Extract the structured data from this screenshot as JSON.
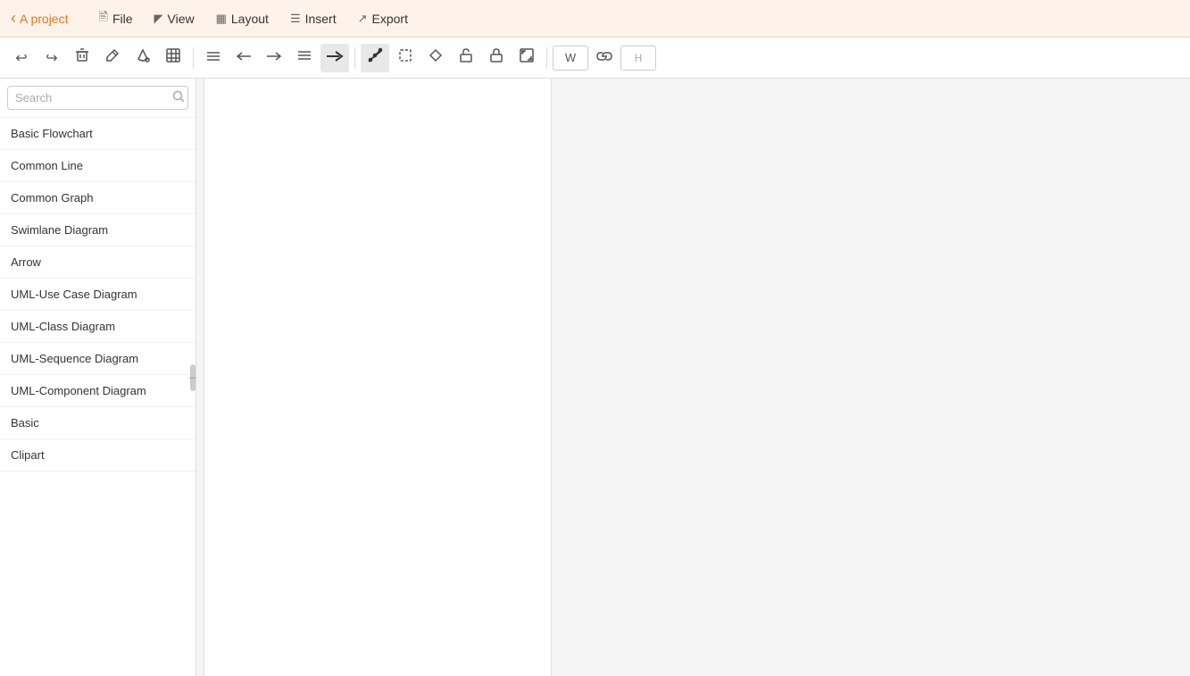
{
  "topbar": {
    "project_label": "A project",
    "back_icon": "◀",
    "menu_items": [
      {
        "id": "file",
        "icon": "🗋",
        "label": "File"
      },
      {
        "id": "view",
        "icon": "⊡",
        "label": "View"
      },
      {
        "id": "layout",
        "icon": "⊞",
        "label": "Layout"
      },
      {
        "id": "insert",
        "icon": "☰+",
        "label": "Insert"
      },
      {
        "id": "export",
        "icon": "↗",
        "label": "Export"
      }
    ]
  },
  "toolbar": {
    "buttons": [
      {
        "id": "undo",
        "icon": "↩",
        "title": "Undo"
      },
      {
        "id": "redo",
        "icon": "↪",
        "title": "Redo"
      },
      {
        "id": "delete",
        "icon": "🗑",
        "title": "Delete"
      },
      {
        "id": "brush",
        "icon": "✏",
        "title": "Brush"
      },
      {
        "id": "fill",
        "icon": "◈",
        "title": "Fill"
      },
      {
        "id": "table",
        "icon": "⊞",
        "title": "Table"
      },
      {
        "id": "rows",
        "icon": "≡",
        "title": "Rows"
      },
      {
        "id": "arrow-left",
        "icon": "←",
        "title": "Arrow Left"
      },
      {
        "id": "arrow-right",
        "icon": "→",
        "title": "Arrow Right",
        "active": true
      },
      {
        "id": "lines",
        "icon": "≡",
        "title": "Lines"
      },
      {
        "id": "arrow-right-bold",
        "icon": "➜",
        "title": "Arrow Right Bold",
        "active": true
      },
      {
        "id": "pen-tool",
        "icon": "✒",
        "title": "Pen Tool"
      },
      {
        "id": "selection",
        "icon": "⊡",
        "title": "Selection"
      },
      {
        "id": "erase",
        "icon": "◇",
        "title": "Erase"
      },
      {
        "id": "lock",
        "icon": "🔓",
        "title": "Lock"
      },
      {
        "id": "lock2",
        "icon": "🔒",
        "title": "Lock 2"
      },
      {
        "id": "expand",
        "icon": "⊡",
        "title": "Expand"
      }
    ],
    "width_input": "W",
    "link_icon": "⛓",
    "height_input": "H"
  },
  "sidebar": {
    "search_placeholder": "Search",
    "items": [
      {
        "id": "basic-flowchart",
        "label": "Basic Flowchart"
      },
      {
        "id": "common-line",
        "label": "Common Line"
      },
      {
        "id": "common-graph",
        "label": "Common Graph"
      },
      {
        "id": "swimlane-diagram",
        "label": "Swimlane Diagram"
      },
      {
        "id": "arrow",
        "label": "Arrow"
      },
      {
        "id": "uml-use-case",
        "label": "UML-Use Case Diagram"
      },
      {
        "id": "uml-class",
        "label": "UML-Class Diagram"
      },
      {
        "id": "uml-sequence",
        "label": "UML-Sequence Diagram"
      },
      {
        "id": "uml-component",
        "label": "UML-Component Diagram"
      },
      {
        "id": "basic",
        "label": "Basic"
      },
      {
        "id": "clipart",
        "label": "Clipart"
      }
    ]
  },
  "colors": {
    "accent": "#e07820",
    "background_topbar": "#fef3ea"
  }
}
